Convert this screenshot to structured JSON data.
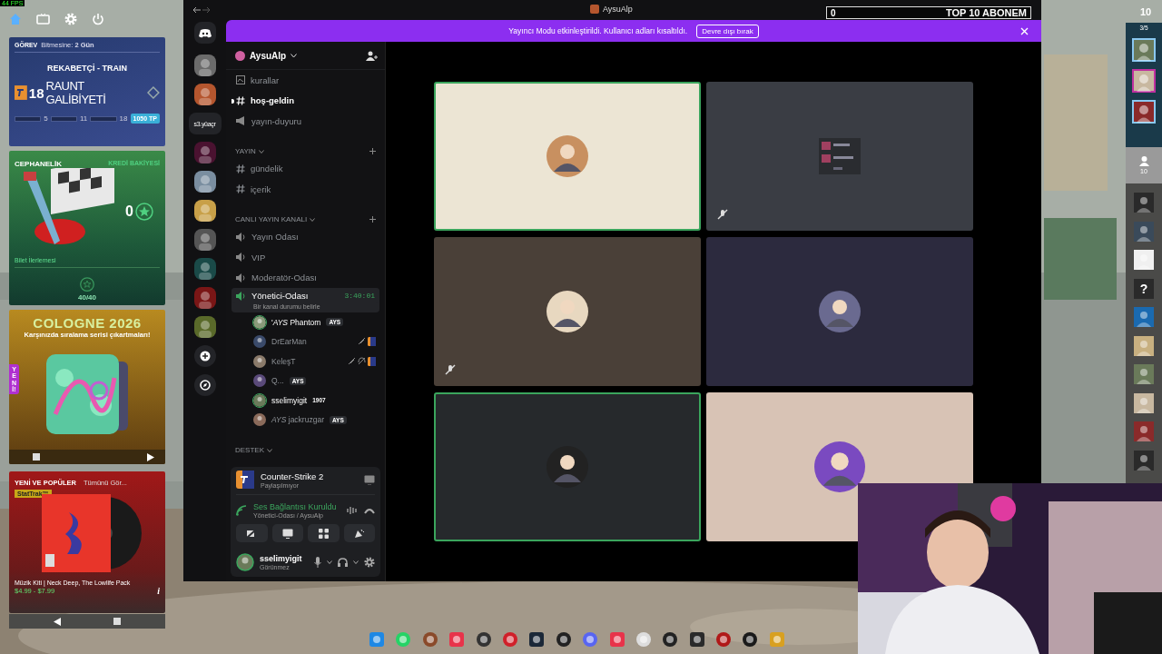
{
  "overlay": {
    "fps": "44 FPS"
  },
  "quest_card": {
    "title": "GÖREV",
    "deadline": "Bitmesine: **2 Gün**",
    "mode": "REKABETÇİ - TRAIN",
    "count": "18",
    "goal": "RAUNT GALİBİYETİ",
    "milestones": [
      "5",
      "11",
      "18"
    ],
    "reward": "1050 TP"
  },
  "armory_card": {
    "title": "CEPHANELİK",
    "credit_label": "KREDİ BAKİYESİ",
    "credits": "0",
    "progress_label": "Bilet İlerlemesi",
    "progress": "40/40"
  },
  "promo_card": {
    "title": "COLOGNE 2026",
    "subtitle": "Karşınızda sıralama serisi çıkartmaları!",
    "badge": "YENİ!"
  },
  "store_card": {
    "title": "YENİ VE POPÜLER",
    "link": "Tümünü Gör...",
    "tag": "StatTrak™",
    "item": "Müzik Kiti | Neck Deep, The Lowlife Pack",
    "price": "$4.99 - $7.99",
    "info": "i"
  },
  "discord": {
    "title": "AysuAlp",
    "banner": {
      "text": "Yayıncı Modu etkinleştirildi. Kullanıcı adları kısaltıldı.",
      "button": "Devre dışı bırak"
    },
    "servers": [
      {
        "kind": "picture"
      },
      {
        "kind": "picture"
      },
      {
        "kind": "text",
        "label": "s3.yüaçr"
      },
      {
        "kind": "picture"
      },
      {
        "kind": "picture"
      },
      {
        "kind": "picture"
      },
      {
        "kind": "picture"
      },
      {
        "kind": "picture"
      },
      {
        "kind": "picture"
      },
      {
        "kind": "picture"
      }
    ],
    "server_name": "AysuAlp",
    "channels": [
      {
        "kind": "rules",
        "name": "kurallar",
        "unread": false,
        "selected": false
      },
      {
        "kind": "text",
        "name": "hoş-geldin",
        "unread": true,
        "selected": false
      },
      {
        "kind": "announce",
        "name": "yayın-duyuru",
        "unread": false,
        "selected": false
      },
      {
        "kind": "category",
        "name": "YAYIN"
      },
      {
        "kind": "text",
        "name": "gündelik",
        "unread": false,
        "selected": false
      },
      {
        "kind": "text",
        "name": "içerik",
        "unread": false,
        "selected": false
      },
      {
        "kind": "category",
        "name": "CANLI YAYIN KANALI"
      },
      {
        "kind": "voice",
        "name": "Yayın Odası",
        "unread": false,
        "selected": false
      },
      {
        "kind": "voice",
        "name": "VIP",
        "unread": false,
        "selected": false
      },
      {
        "kind": "voice",
        "name": "Moderatör-Odası",
        "unread": false,
        "selected": false
      },
      {
        "kind": "voice",
        "name": "Yönetici-Odası",
        "unread": false,
        "selected": true,
        "timer": "3:40:01",
        "status": "Bir kanal durumu belirle"
      }
    ],
    "members": [
      {
        "name": "'*AYS* Phantom",
        "speaking": true,
        "muted": false,
        "deafened": false,
        "playing": false,
        "tag": "AYS"
      },
      {
        "name": "DrEarMan",
        "speaking": false,
        "muted": true,
        "deafened": false,
        "playing": true
      },
      {
        "name": "KeleşT",
        "speaking": false,
        "muted": true,
        "deafened": true,
        "playing": true
      },
      {
        "name": "Q...",
        "speaking": false,
        "muted": false,
        "deafened": false,
        "playing": false,
        "tag": "AYS"
      },
      {
        "name": "sselimyigit",
        "speaking": true,
        "muted": false,
        "deafened": false,
        "playing": false,
        "trophy": "1907"
      },
      {
        "name": "*AYS* jackruzgar",
        "speaking": false,
        "muted": false,
        "deafened": false,
        "playing": false,
        "tag": "AYS"
      }
    ],
    "next_category": "DESTEK",
    "activity": {
      "game": "Counter-Strike 2",
      "status": "Paylaşılmıyor"
    },
    "voice": {
      "status": "Ses Bağlantısı Kuruldu",
      "location": "Yönetici-Odası / AysuAlp"
    },
    "user": {
      "name": "sselimyigit",
      "status": "Görünmez"
    },
    "tiles": [
      {
        "kind": "avatar",
        "speaking": true,
        "muted": false,
        "color": "#ece5d4"
      },
      {
        "kind": "screen",
        "speaking": false,
        "muted": true,
        "color": "#3a3d44"
      },
      {
        "kind": "avatar",
        "speaking": false,
        "muted": true,
        "color": "#4a4038"
      },
      {
        "kind": "avatar",
        "speaking": false,
        "muted": false,
        "color": "#2c2a3e"
      },
      {
        "kind": "avatar",
        "speaking": true,
        "muted": false,
        "color": "#26292c"
      },
      {
        "kind": "avatar",
        "speaking": false,
        "muted": false,
        "color": "#d8c3b5"
      }
    ]
  },
  "sub_goal": {
    "current": "0",
    "title": "TOP 10 ABONEM",
    "target": "10"
  },
  "queue": {
    "count": "3/5",
    "viewers": "10",
    "unknown": "?"
  }
}
